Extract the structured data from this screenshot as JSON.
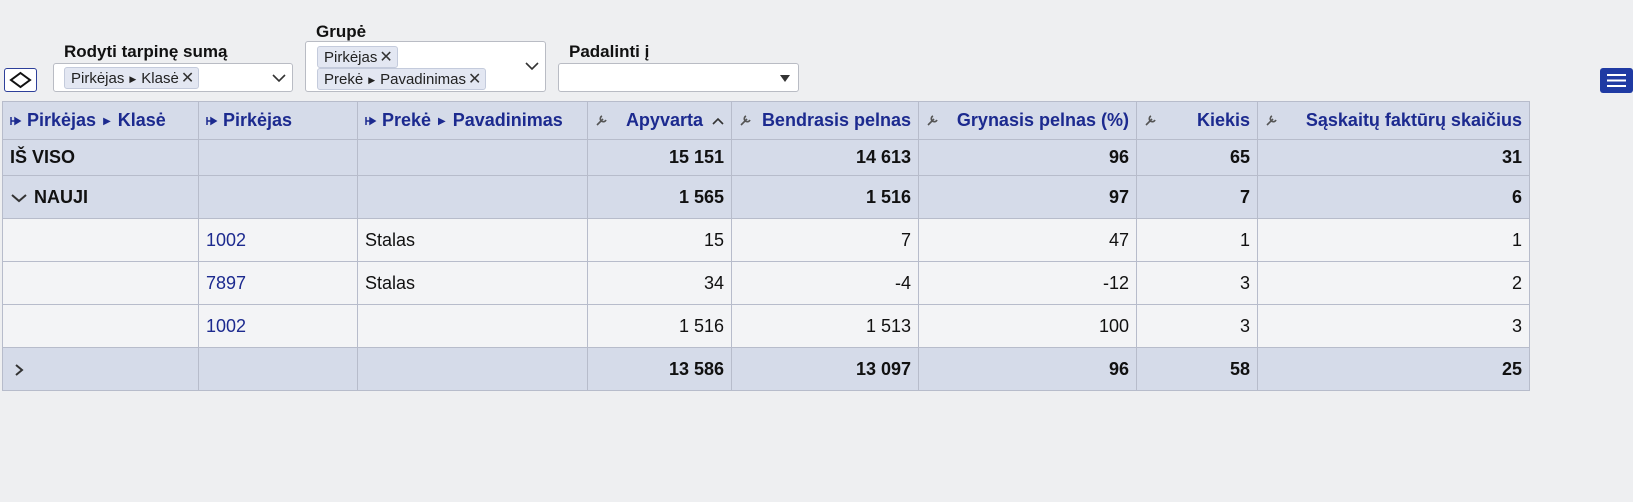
{
  "controls": {
    "subtotal": {
      "label": "Rodyti tarpinę sumą",
      "chip": {
        "part1": "Pirkėjas",
        "part2": "Klasė"
      }
    },
    "group": {
      "label": "Grupė",
      "chips": [
        {
          "text": "Pirkėjas"
        },
        {
          "part1": "Prekė",
          "part2": "Pavadinimas"
        }
      ]
    },
    "split": {
      "label": "Padalinti į",
      "value": ""
    }
  },
  "table": {
    "headers": {
      "col1": {
        "part1": "Pirkėjas",
        "part2": "Klasė"
      },
      "col2": "Pirkėjas",
      "col3": {
        "part1": "Prekė",
        "part2": "Pavadinimas"
      },
      "col4": "Apyvarta",
      "col5": "Bendrasis pelnas",
      "col6": "Grynasis pelnas (%)",
      "col7": "Kiekis",
      "col8": "Sąskaitų faktūrų skaičius"
    },
    "total": {
      "label": "IŠ VISO",
      "apyvarta": "15 151",
      "bendrasis": "14 613",
      "grynasis": "96",
      "kiekis": "65",
      "saskaitos": "31"
    },
    "group1": {
      "label": "NAUJI",
      "apyvarta": "1 565",
      "bendrasis": "1 516",
      "grynasis": "97",
      "kiekis": "7",
      "saskaitos": "6"
    },
    "rows": [
      {
        "pirkejas": "1002",
        "preke": "Stalas",
        "apyvarta": "15",
        "bendrasis": "7",
        "grynasis": "47",
        "kiekis": "1",
        "saskaitos": "1"
      },
      {
        "pirkejas": "7897",
        "preke": "Stalas",
        "apyvarta": "34",
        "bendrasis": "-4",
        "grynasis": "-12",
        "kiekis": "3",
        "saskaitos": "2"
      },
      {
        "pirkejas": "1002",
        "preke": "",
        "apyvarta": "1 516",
        "bendrasis": "1 513",
        "grynasis": "100",
        "kiekis": "3",
        "saskaitos": "3"
      }
    ],
    "group2": {
      "label": "",
      "apyvarta": "13 586",
      "bendrasis": "13 097",
      "grynasis": "96",
      "kiekis": "58",
      "saskaitos": "25"
    }
  },
  "icons": {
    "toggle": "collapse-expand-icon",
    "menu": "hamburger-menu-icon",
    "pin": "pin-icon",
    "wrench": "wrench-icon",
    "sort": "sort-ascending-icon",
    "remove": "remove-x-icon",
    "dropdown": "chevron-down-icon",
    "expand": "chevron-right-icon",
    "collapse": "chevron-down-icon"
  },
  "colors": {
    "header_text": "#1c2a8f",
    "header_bg": "#d5dbe9",
    "menu_button": "#1f3aa3"
  }
}
